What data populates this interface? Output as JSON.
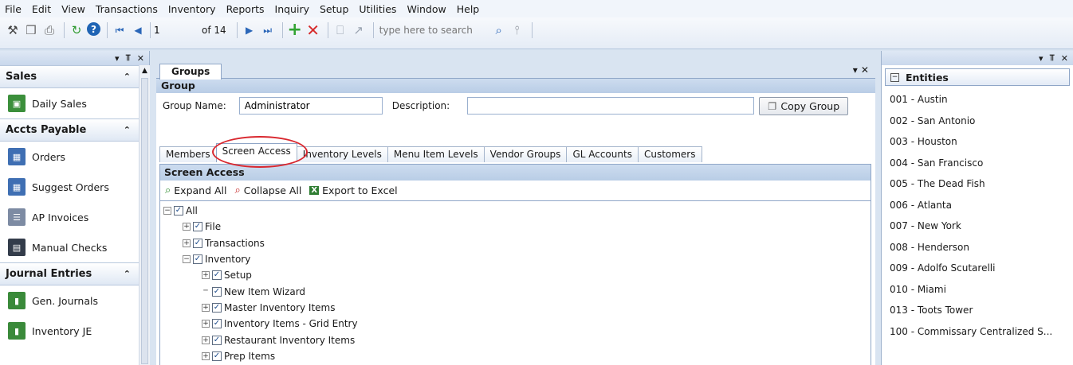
{
  "menu": [
    "File",
    "Edit",
    "View",
    "Transactions",
    "Inventory",
    "Reports",
    "Inquiry",
    "Setup",
    "Utilities",
    "Window",
    "Help"
  ],
  "toolbar": {
    "record_value": "1",
    "of_label": "of 14",
    "search_placeholder": "type here to search"
  },
  "left_pane": {
    "sections": [
      {
        "title": "Sales",
        "items": [
          {
            "label": "Daily Sales",
            "icon": "register-icon"
          }
        ]
      },
      {
        "title": "Accts Payable",
        "items": [
          {
            "label": "Orders",
            "icon": "grid-icon"
          },
          {
            "label": "Suggest Orders",
            "icon": "suggest-grid-icon"
          },
          {
            "label": "AP Invoices",
            "icon": "invoice-icon"
          },
          {
            "label": "Manual Checks",
            "icon": "checks-icon"
          }
        ]
      },
      {
        "title": "Journal Entries",
        "items": [
          {
            "label": "Gen. Journals",
            "icon": "journal-icon"
          },
          {
            "label": "Inventory JE",
            "icon": "inventory-journal-icon"
          }
        ]
      }
    ]
  },
  "doc_tab": "Groups",
  "group": {
    "bar_title": "Group",
    "name_label": "Group Name:",
    "name_value": "Administrator",
    "desc_label": "Description:",
    "desc_value": "",
    "copy_button": "Copy Group"
  },
  "tabs": [
    {
      "label": "Members",
      "active": false
    },
    {
      "label": "Screen Access",
      "active": true
    },
    {
      "label": "Inventory Levels",
      "active": false
    },
    {
      "label": "Menu Item Levels",
      "active": false
    },
    {
      "label": "Vendor Groups",
      "active": false
    },
    {
      "label": "GL Accounts",
      "active": false
    },
    {
      "label": "Customers",
      "active": false
    }
  ],
  "screen_access": {
    "title": "Screen Access",
    "expand_all": "Expand All",
    "collapse_all": "Collapse All",
    "export": "Export to Excel",
    "tree": [
      {
        "label": "All",
        "level": 0,
        "expander": "minus",
        "checked": true
      },
      {
        "label": "File",
        "level": 1,
        "expander": "plus",
        "checked": true
      },
      {
        "label": "Transactions",
        "level": 1,
        "expander": "plus",
        "checked": true
      },
      {
        "label": "Inventory",
        "level": 1,
        "expander": "minus",
        "checked": true
      },
      {
        "label": "Setup",
        "level": 2,
        "expander": "plus",
        "checked": true
      },
      {
        "label": "New Item Wizard",
        "level": 2,
        "expander": "none",
        "checked": true
      },
      {
        "label": "Master Inventory Items",
        "level": 2,
        "expander": "plus",
        "checked": true
      },
      {
        "label": "Inventory Items - Grid Entry",
        "level": 2,
        "expander": "plus",
        "checked": true
      },
      {
        "label": "Restaurant Inventory Items",
        "level": 2,
        "expander": "plus",
        "checked": true
      },
      {
        "label": "Prep Items",
        "level": 2,
        "expander": "plus",
        "checked": true
      }
    ]
  },
  "entities": {
    "title": "Entities",
    "items": [
      "001 - Austin",
      "002 - San Antonio",
      "003 - Houston",
      "004 - San Francisco",
      "005 - The Dead Fish",
      "006 - Atlanta",
      "007 - New York",
      "008 - Henderson",
      "009 - Adolfo Scutarelli",
      "010 - Miami",
      "013 - Toots Tower",
      "100 - Commissary Centralized S..."
    ]
  },
  "colors": {
    "accent": "#cddcef",
    "highlight_ring": "#d9282f",
    "checkmark": "#1d4c8c"
  }
}
